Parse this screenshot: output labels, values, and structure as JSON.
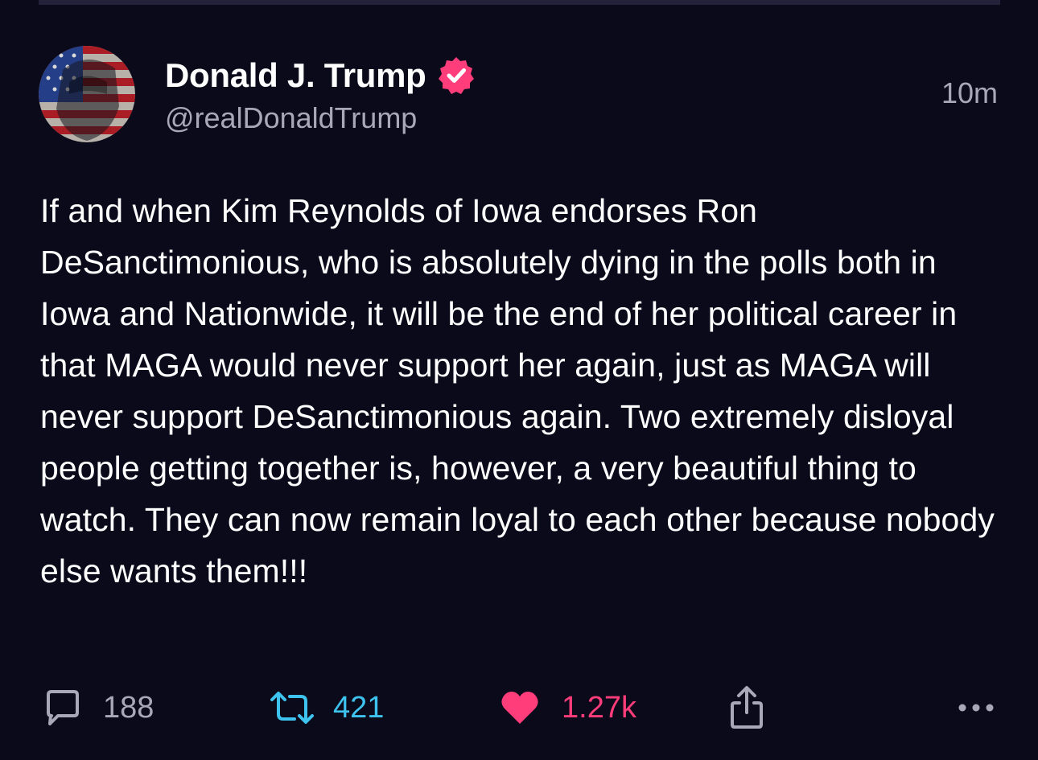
{
  "post": {
    "author": {
      "display_name": "Donald J. Trump",
      "handle": "@realDonaldTrump",
      "verified": true,
      "avatar_icon": "flag-portrait-avatar"
    },
    "timestamp": "10m",
    "text": "If and when Kim Reynolds of Iowa endorses Ron DeSanctimonious, who is absolutely dying in the polls both in Iowa and Nationwide, it will be the end of her political career in that MAGA would never support her again, just as MAGA will never support DeSanctimonious again. Two extremely disloyal people getting together is, however, a very beautiful thing to watch. They can now remain loyal to each other because nobody else wants them!!!",
    "actions": {
      "replies": "188",
      "reposts": "421",
      "likes": "1.27k",
      "reply_icon": "speech-bubble-icon",
      "repost_icon": "repost-icon",
      "like_icon": "heart-icon",
      "share_icon": "share-icon",
      "more_icon": "more-dots-icon"
    }
  },
  "colors": {
    "background": "#0b0a1a",
    "muted_text": "#a9a8b8",
    "verified_badge": "#ff3d7a",
    "repost": "#3ec3ee",
    "like": "#ff3d7a"
  }
}
